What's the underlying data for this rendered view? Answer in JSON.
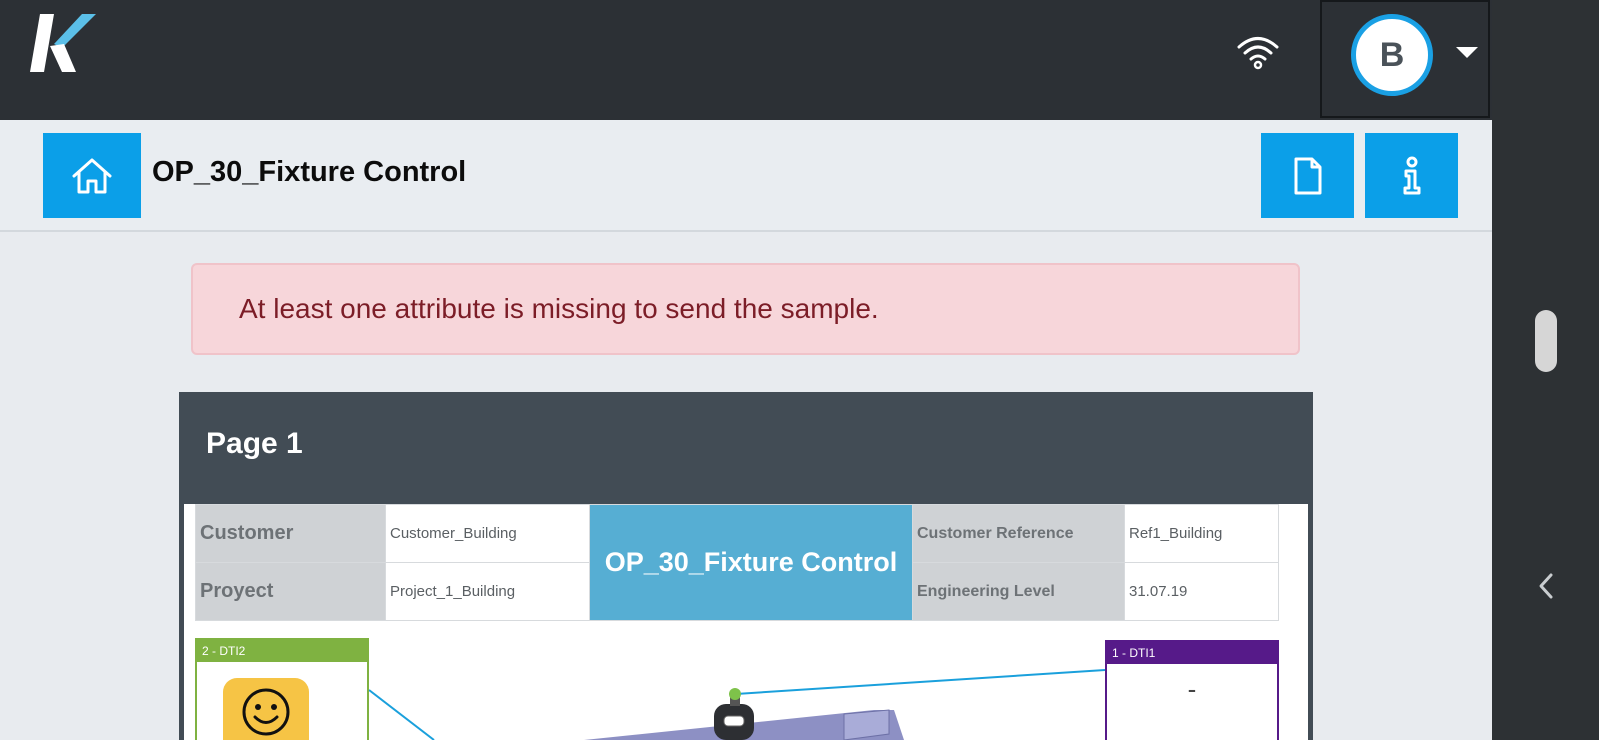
{
  "topbar": {
    "logo_icon": "k-logo-icon",
    "wifi_icon": "wifi-icon",
    "user_initial": "B",
    "dropdown_icon": "caret-down-icon"
  },
  "titlebar": {
    "title": "OP_30_Fixture Control",
    "home_icon": "home-icon",
    "document_icon": "document-icon",
    "info_icon": "info-icon"
  },
  "alert": {
    "message": "At least one attribute is missing to send the sample."
  },
  "page": {
    "title": "Page 1",
    "header_table": {
      "customer_label": "Customer",
      "customer_value": "Customer_Building",
      "project_label": "Proyect",
      "project_value": "Project_1_Building",
      "center_title": "OP_30_Fixture Control",
      "customer_ref_label": "Customer Reference",
      "customer_ref_value": "Ref1_Building",
      "eng_level_label": "Engineering Level",
      "eng_level_value": "31.07.19"
    },
    "dti2": {
      "label": "2 - DTI2",
      "icon": "smiley-icon"
    },
    "dti1": {
      "label": "1 - DTI1",
      "value": "-"
    }
  },
  "colors": {
    "accent": "#0b9fe8",
    "dti2": "#7fb241",
    "dti1": "#561a89",
    "alert_bg": "#f7d6da",
    "alert_text": "#7c1d27"
  }
}
